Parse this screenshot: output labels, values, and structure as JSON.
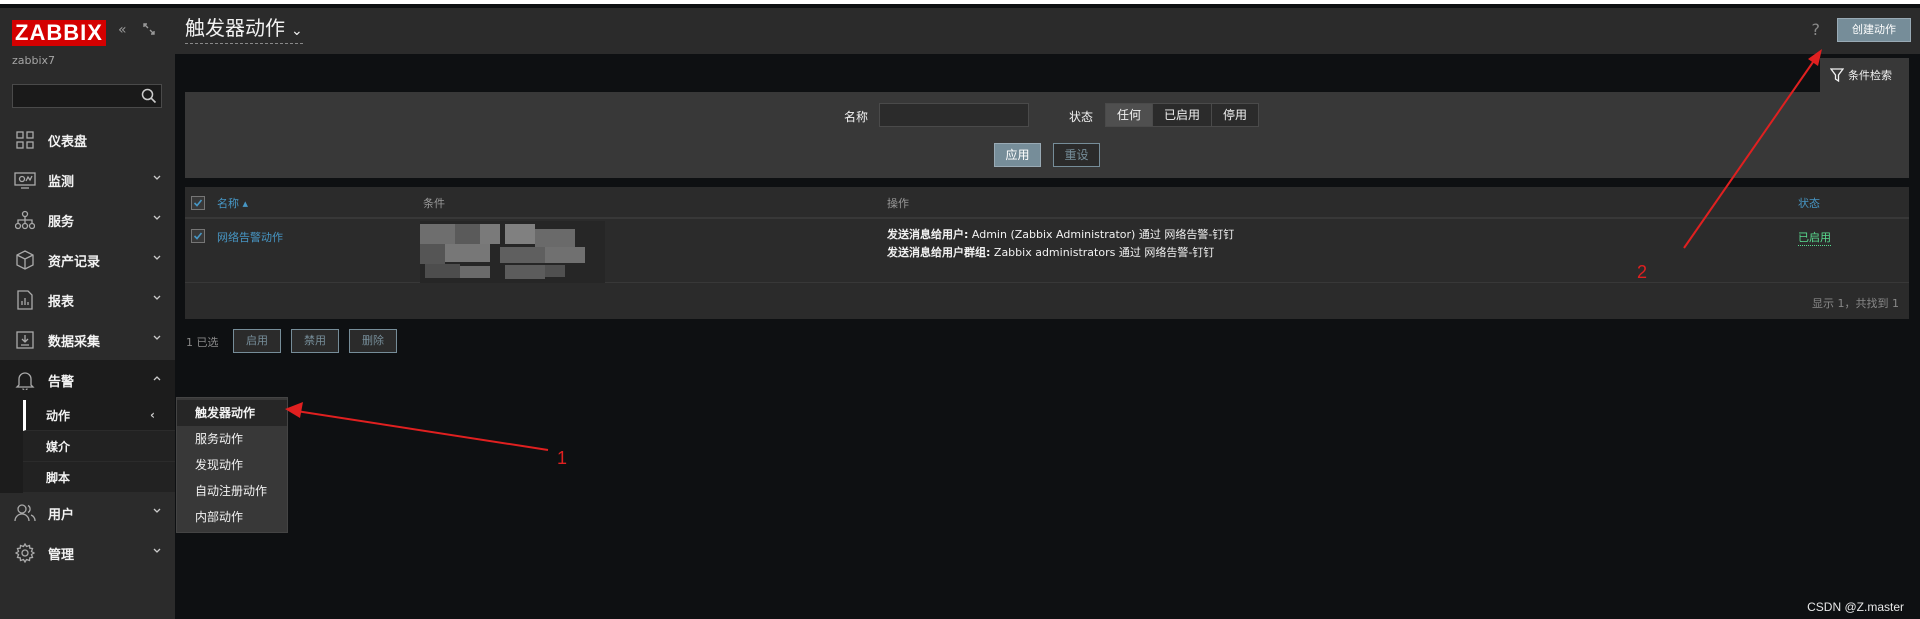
{
  "sidebar": {
    "logo": "ZABBIX",
    "host": "zabbix7",
    "search_placeholder": "",
    "items": [
      {
        "label": "仪表盘",
        "icon": "dashboard-icon"
      },
      {
        "label": "监测",
        "icon": "monitoring-icon"
      },
      {
        "label": "服务",
        "icon": "services-icon"
      },
      {
        "label": "资产记录",
        "icon": "inventory-icon"
      },
      {
        "label": "报表",
        "icon": "reports-icon"
      },
      {
        "label": "数据采集",
        "icon": "data-collection-icon"
      },
      {
        "label": "告警",
        "icon": "bell-icon"
      },
      {
        "label": "用户",
        "icon": "users-icon"
      },
      {
        "label": "管理",
        "icon": "gear-icon"
      }
    ],
    "alerts_submenu": [
      {
        "label": "动作"
      },
      {
        "label": "媒介"
      },
      {
        "label": "脚本"
      }
    ],
    "action_indicator": "‹"
  },
  "popup_menu": [
    {
      "label": "触发器动作"
    },
    {
      "label": "服务动作"
    },
    {
      "label": "发现动作"
    },
    {
      "label": "自动注册动作"
    },
    {
      "label": "内部动作"
    }
  ],
  "header": {
    "title": "触发器动作",
    "help": "?",
    "create_button": "创建动作"
  },
  "filter": {
    "tab_label": "条件检索",
    "name_label": "名称",
    "name_value": "",
    "status_label": "状态",
    "status_options": [
      "任何",
      "已启用",
      "停用"
    ],
    "status_selected": "任何",
    "apply": "应用",
    "reset": "重设"
  },
  "table": {
    "columns": {
      "name": "名称 ▴",
      "conditions": "条件",
      "operations": "操作",
      "status": "状态"
    },
    "rows": [
      {
        "name": "网络告警动作",
        "op1_prefix": "发送消息给用户:",
        "op1_text": " Admin (Zabbix Administrator) 通过 网络告警-钉钉",
        "op2_prefix": "发送消息给用户群组:",
        "op2_text": " Zabbix administrators 通过 网络告警-钉钉",
        "status": "已启用"
      }
    ],
    "footer": "显示 1，共找到 1"
  },
  "actions": {
    "selected": "1 已选",
    "enable": "启用",
    "disable": "禁用",
    "delete": "删除"
  },
  "annotations": {
    "one": "1",
    "two": "2"
  },
  "watermark": "CSDN @Z.master",
  "colors": {
    "accent": "#768d99",
    "link": "#4796c4",
    "enabled": "#59db8f",
    "logo": "#d40000",
    "arrow": "#e02020"
  }
}
